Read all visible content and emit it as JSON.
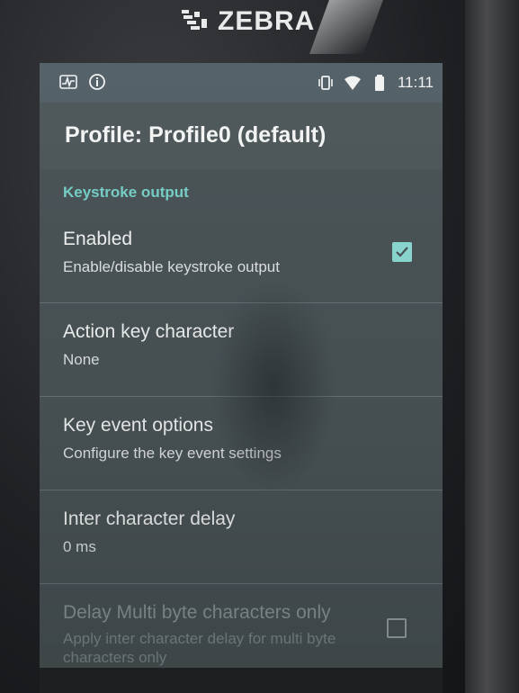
{
  "device": {
    "brand": "ZEBRA"
  },
  "status_bar": {
    "left_icons": [
      "pulse-icon",
      "info-icon"
    ],
    "right_icons": [
      "vibrate-icon",
      "wifi-icon",
      "battery-icon"
    ],
    "time": "11:11"
  },
  "header": {
    "title": "Profile: Profile0 (default)"
  },
  "section": {
    "category": "Keystroke output"
  },
  "preferences": [
    {
      "title": "Enabled",
      "subtitle": "Enable/disable keystroke output",
      "checkbox": true,
      "checked": true,
      "enabled": true
    },
    {
      "title": "Action key character",
      "subtitle": "None",
      "checkbox": false,
      "enabled": true
    },
    {
      "title": "Key event options",
      "subtitle": "Configure the key event settings",
      "checkbox": false,
      "enabled": true
    },
    {
      "title": "Inter character delay",
      "subtitle": "0 ms",
      "checkbox": false,
      "enabled": true
    },
    {
      "title": "Delay Multi byte characters only",
      "subtitle": "Apply inter character delay for multi byte characters only",
      "checkbox": true,
      "checked": false,
      "enabled": false
    }
  ],
  "colors": {
    "accent": "#79d3cb",
    "checkbox_fill": "#8fdcd6",
    "screen_bg": "#4b5558"
  }
}
